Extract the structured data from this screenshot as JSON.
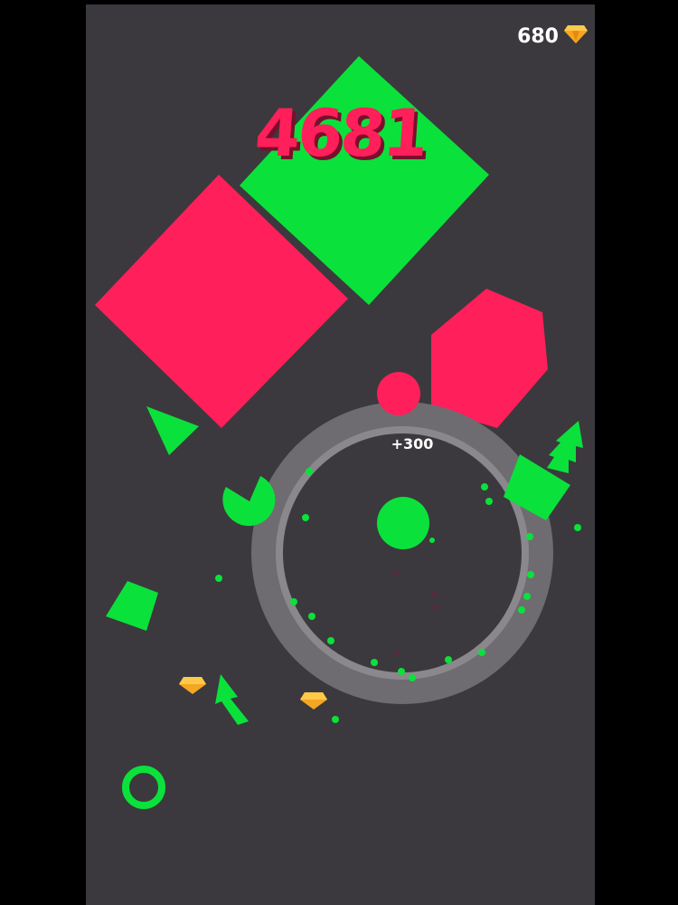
{
  "hud": {
    "score": "4681",
    "gem_count": "680",
    "gem_icon": "gem-icon"
  },
  "popup": {
    "bonus_text": "+300"
  },
  "colors": {
    "background": "#3b393d",
    "enemy_red": "#ff1f5a",
    "friendly_green": "#0be13b",
    "ring": "#7c7a7f",
    "gem": "#f6a623"
  }
}
